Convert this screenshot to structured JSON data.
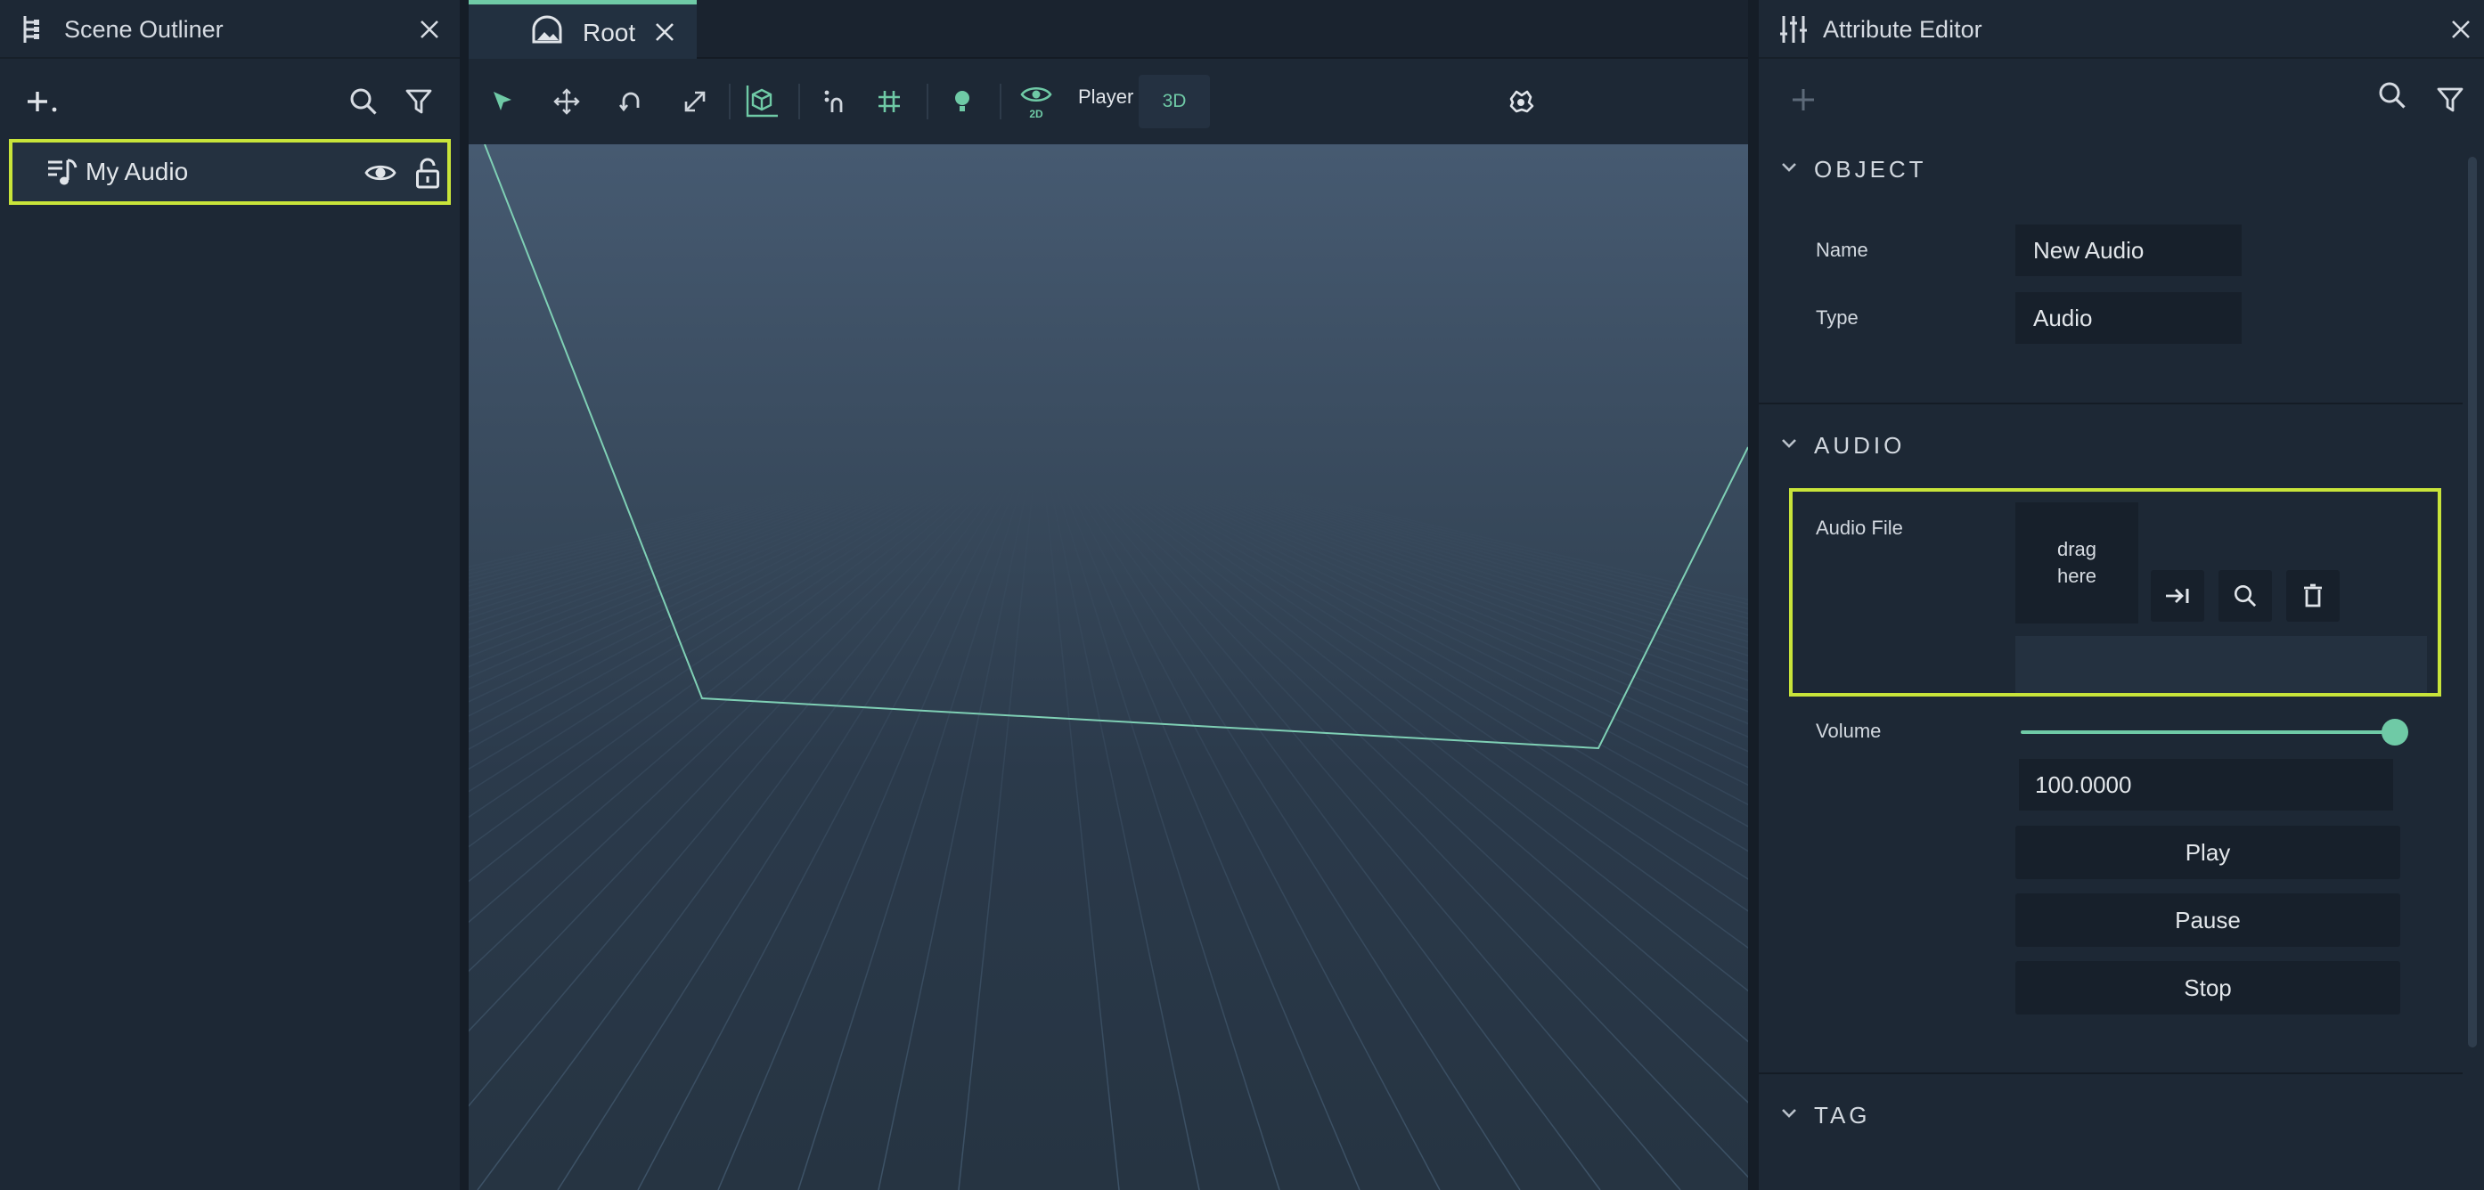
{
  "colors": {
    "accent": "#6fcaa6",
    "highlight": "#c8e43a",
    "panel": "#1d2835",
    "field": "#17202b"
  },
  "outliner": {
    "title": "Scene Outliner",
    "items": [
      {
        "label": "My Audio",
        "icon": "audio-icon"
      }
    ]
  },
  "viewport": {
    "tab_label": "Root",
    "toolbar": {
      "player_label": "Player",
      "mode_label": "3D",
      "view_2d_label": "2D"
    }
  },
  "attributes": {
    "title": "Attribute Editor",
    "sections": {
      "object": "OBJECT",
      "audio": "AUDIO",
      "tag": "TAG"
    },
    "object": {
      "name_label": "Name",
      "name_value": "New Audio",
      "type_label": "Type",
      "type_value": "Audio"
    },
    "audio": {
      "file_label": "Audio File",
      "dropzone_line1": "drag",
      "dropzone_line2": "here",
      "volume_label": "Volume",
      "volume_value": "100.0000",
      "volume_level": 1.0,
      "play_label": "Play",
      "pause_label": "Pause",
      "stop_label": "Stop"
    }
  }
}
